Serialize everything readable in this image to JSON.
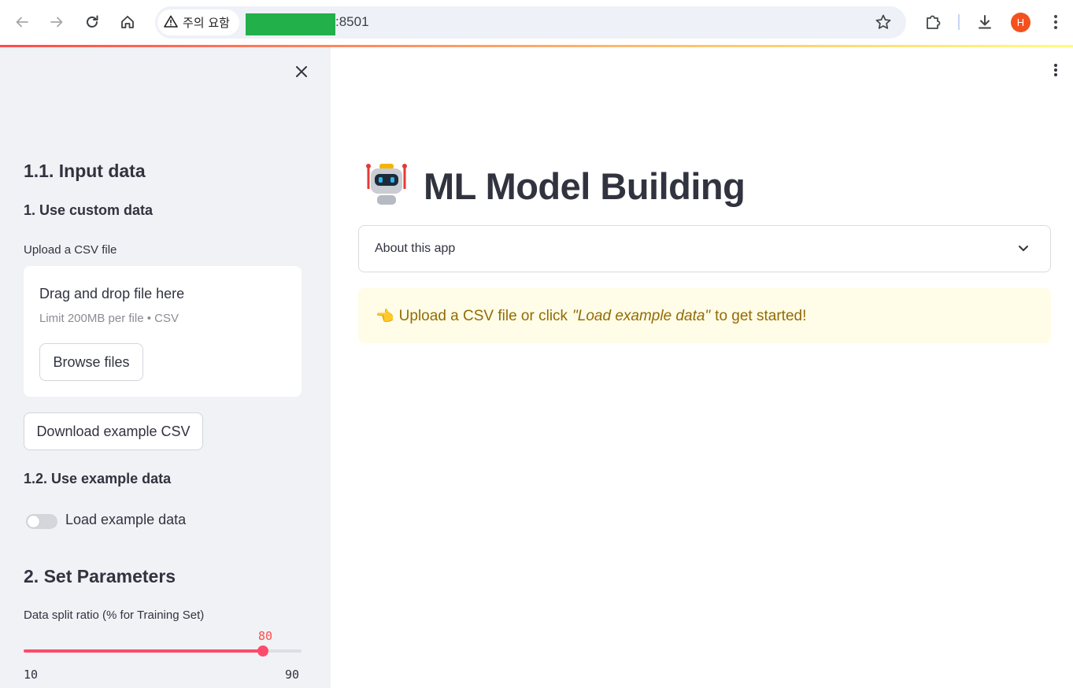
{
  "browser": {
    "security_chip": "주의 요함",
    "url_port": ":8501",
    "avatar_initial": "H",
    "icons": [
      "back-icon",
      "forward-icon",
      "reload-icon",
      "home-icon",
      "warning-icon",
      "star-icon",
      "extensions-icon",
      "download-icon",
      "more-vert-icon"
    ]
  },
  "sidebar": {
    "section_input": "1.1. Input data",
    "custom_data_heading": "1. Use custom data",
    "upload_label": "Upload a CSV file",
    "dropzone_title": "Drag and drop file here",
    "dropzone_limit": "Limit 200MB per file • CSV",
    "browse_button": "Browse files",
    "download_button": "Download example CSV",
    "example_heading": "1.2. Use example data",
    "toggle_label": "Load example data",
    "toggle_on": false,
    "params_heading": "2. Set Parameters",
    "slider_label": "Data split ratio (% for Training Set)",
    "slider_value": "80",
    "slider_min": "10",
    "slider_max": "90"
  },
  "main": {
    "title_emoji": "🤖",
    "title": "ML Model Building",
    "expander_label": "About this app",
    "alert_emoji": "👈",
    "alert_before": "Upload a CSV file or click",
    "alert_italic": "\"Load example data\"",
    "alert_after": "to get started!"
  },
  "colors": {
    "accent": "#ff4b4b",
    "slider": "#ff4b6b",
    "sidebar_bg": "#f0f2f6",
    "alert_bg": "#fffce7",
    "alert_text": "#926c05",
    "redaction": "#22b04b"
  }
}
